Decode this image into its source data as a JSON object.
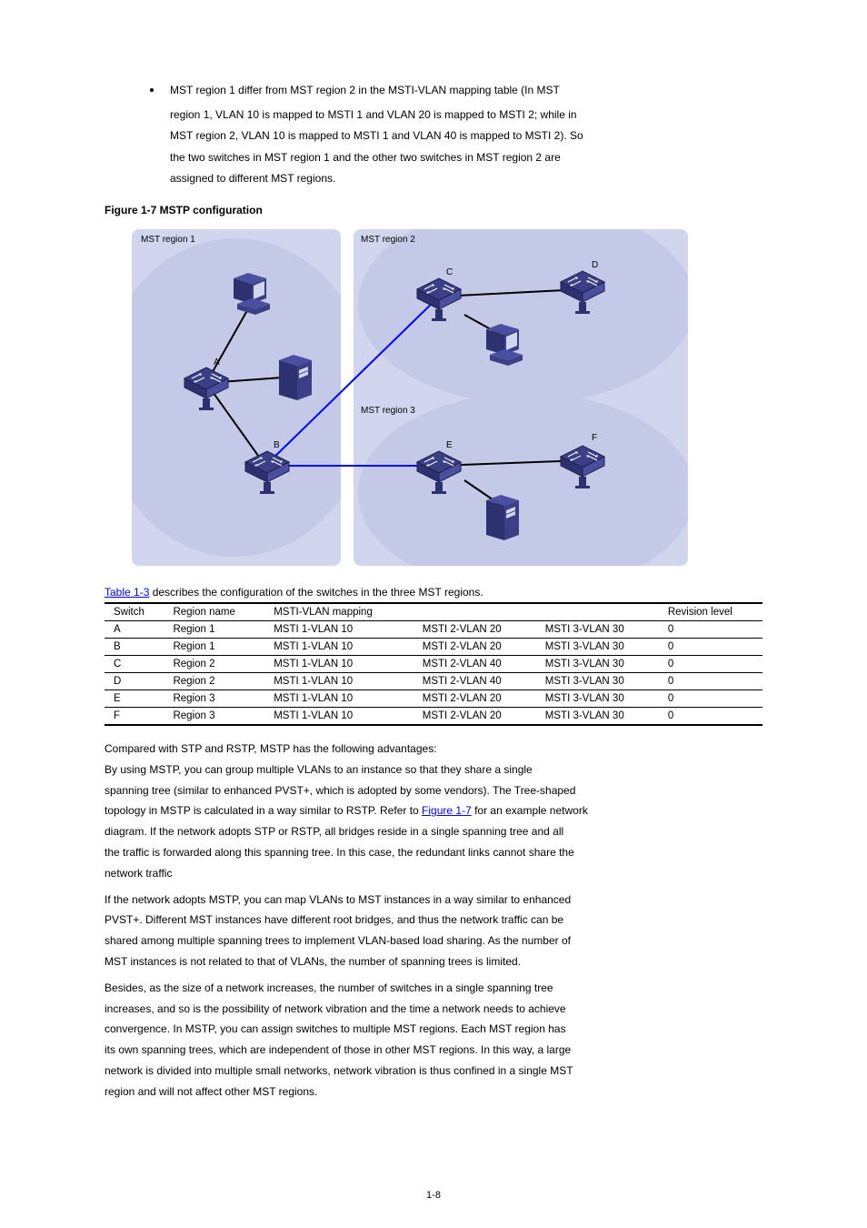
{
  "bullet": {
    "line1": "MST region 1 differ from MST region 2 in the MSTI-VLAN mapping table (In MST",
    "line2": "region 1, VLAN 10 is mapped to MSTI 1 and VLAN 20 is mapped to MSTI 2; while in",
    "line3": "MST region 2, VLAN 10 is mapped to MSTI 1 and VLAN 40 is mapped to MSTI 2). So",
    "line4": "the two switches in MST region 1 and the other two switches in MST region 2 are",
    "line5": "assigned to different MST regions."
  },
  "figure_caption": "Figure 1-7 MSTP configuration",
  "diagram": {
    "labels": {
      "region1": "MST region 1",
      "region2": "MST region 2",
      "region3": "MST region 3",
      "a": "A",
      "b": "B",
      "c": "C",
      "d": "D",
      "e": "E",
      "f": "F"
    }
  },
  "table_caption_link": "Table 1-3",
  "table_caption_rest": " describes the configuration of the switches in the three MST regions.",
  "chart_data": {
    "type": "table",
    "columns": [
      "Switch",
      "Region name",
      "MSTI-VLAN mapping",
      "",
      "",
      "Revision level"
    ],
    "rows": [
      [
        "A",
        "Region 1",
        "MSTI 1-VLAN 10",
        "MSTI 2-VLAN 20",
        "MSTI 3-VLAN 30",
        "0"
      ],
      [
        "B",
        "Region 1",
        "MSTI 1-VLAN 10",
        "MSTI 2-VLAN 20",
        "MSTI 3-VLAN 30",
        "0"
      ],
      [
        "C",
        "Region 2",
        "MSTI 1-VLAN 10",
        "MSTI 2-VLAN 40",
        "MSTI 3-VLAN 30",
        "0"
      ],
      [
        "D",
        "Region 2",
        "MSTI 1-VLAN 10",
        "MSTI 2-VLAN 40",
        "MSTI 3-VLAN 30",
        "0"
      ],
      [
        "E",
        "Region 3",
        "MSTI 1-VLAN 10",
        "MSTI 2-VLAN 20",
        "MSTI 3-VLAN 30",
        "0"
      ],
      [
        "F",
        "Region 3",
        "MSTI 1-VLAN 10",
        "MSTI 2-VLAN 20",
        "MSTI 3-VLAN 30",
        "0"
      ]
    ]
  },
  "after_table": {
    "p1a": "Compared with STP and RSTP, MSTP has the following advantages:",
    "p1b": "By using MSTP, you can group multiple VLANs to an instance so that they share a single",
    "p1c": "spanning tree (similar to enhanced PVST+, which is adopted by some vendors). The Tree-shaped",
    "p1d": "topology in MSTP is calculated in a way similar to RSTP. Refer to ",
    "fig_link": "Figure 1-7",
    "p1e": " for an example network",
    "p1f": "diagram. If the network adopts STP or RSTP, all bridges reside in a single spanning tree and all",
    "p1g": "the traffic is forwarded along this spanning tree. In this case, the redundant links cannot share the",
    "p1h": "network traffic",
    "p2a": "If the network adopts MSTP, you can map VLANs to MST instances in a way similar to enhanced",
    "p2b": "PVST+. Different MST instances have different root bridges, and thus the network traffic can be",
    "p2c": "shared among multiple spanning trees to implement VLAN-based load sharing. As the number of",
    "p2d": "MST instances is not related to that of VLANs, the number of spanning trees is limited.",
    "p3a": "Besides, as the size of a network increases, the number of switches in a single spanning tree",
    "p3b": "increases, and so is the possibility of network vibration and the time a network needs to achieve",
    "p3c": "convergence. In MSTP, you can assign switches to multiple MST regions. Each MST region has",
    "p3d": "its own spanning trees, which are independent of those in other MST regions. In this way, a large",
    "p3e": "network is divided into multiple small networks, network vibration is thus confined in a single MST",
    "p3f": "region and will not affect other MST regions."
  },
  "page_number": "1-8"
}
